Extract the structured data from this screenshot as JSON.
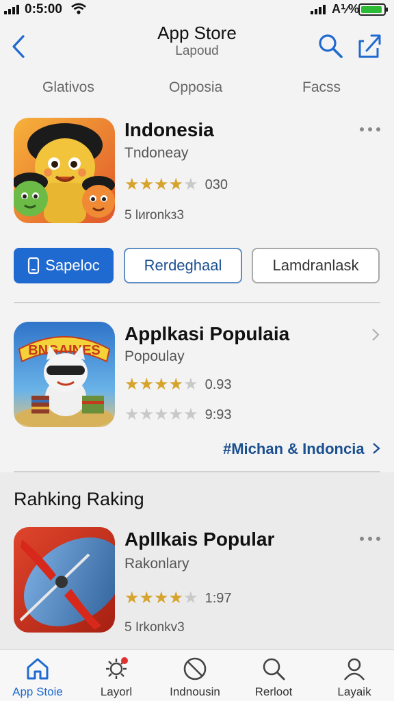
{
  "status_bar": {
    "time": "0:5:00",
    "carrier": "A⅟%"
  },
  "nav": {
    "title": "App Store",
    "subtitle": "Lapoud"
  },
  "tabs": [
    "Glativos",
    "Opposia",
    "Facss"
  ],
  "apps": [
    {
      "name": "Indonesia",
      "subtitle": "Tndoneay",
      "rating": 4,
      "rating_text": "030",
      "extra": "5 lиronkз3"
    },
    {
      "name": "Applkasi Populaia",
      "subtitle": "Popoulay",
      "rating": 4,
      "rating_text": "0.93",
      "rating2": 0,
      "rating2_text": "9:93",
      "icon_banner": "BNGAINES"
    },
    {
      "name": "Apllkais Popular",
      "subtitle": "Rakonlary",
      "rating": 4,
      "rating_text": "1:97",
      "extra": "5 Irkonkv3"
    }
  ],
  "buttons": {
    "primary": "Sapeloc",
    "secondary": "Rerdeghaal",
    "tertiary": "Lamdranlask"
  },
  "link": "#Michan & Indoncia",
  "section_title": "Rahking Raking",
  "tabbar": [
    {
      "label": "App Stoie",
      "icon": "app-store-icon",
      "active": true
    },
    {
      "label": "Layorl",
      "icon": "gear-icon",
      "active": false
    },
    {
      "label": "Indnousin",
      "icon": "blocked-icon",
      "active": false
    },
    {
      "label": "Rerloot",
      "icon": "search-icon",
      "active": false
    },
    {
      "label": "Layaik",
      "icon": "person-icon",
      "active": false
    }
  ],
  "colors": {
    "accent": "#1f6ad0",
    "link": "#1a4f90",
    "star": "#d6a32c",
    "battery": "#2dbb37"
  }
}
